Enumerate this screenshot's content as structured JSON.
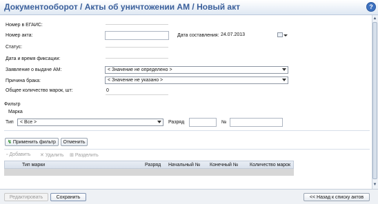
{
  "header": {
    "title": "Документооборот / Акты об уничтожении АМ / Новый акт",
    "help_icon": "?"
  },
  "form": {
    "egais_label": "Номер в ЕГАИС:",
    "act_number_label": "Номер акта:",
    "act_number_value": "",
    "date_label": "Дата составления:",
    "date_value": "24.07.2013",
    "status_label": "Статус:",
    "fix_datetime_label": "Дата и время фиксации:",
    "application_label": "Заявление о выдаче АМ:",
    "application_value": "< Значение не определено >",
    "defect_label": "Причина брака:",
    "defect_value": "< Значение не указано >",
    "total_label": "Общее количество марок, шт:",
    "total_value": "0"
  },
  "filter": {
    "title": "Фильтр",
    "mark_label": "Марка",
    "type_label": "Тип",
    "type_value": "< Все >",
    "rank_label": "Разряд",
    "number_label": "№",
    "apply_button": "Применить фильтр",
    "cancel_button": "Отменить"
  },
  "toolbar": {
    "add": "Добавить",
    "delete": "Удалить",
    "split": "Разделить"
  },
  "table": {
    "columns": [
      "Тип марки",
      "Разряд",
      "Начальный №",
      "Конечный №",
      "Количество марок"
    ]
  },
  "footer": {
    "edit_button": "Редактировать",
    "save_button": "Сохранить",
    "back_button": "<< Назад к списку актов"
  }
}
